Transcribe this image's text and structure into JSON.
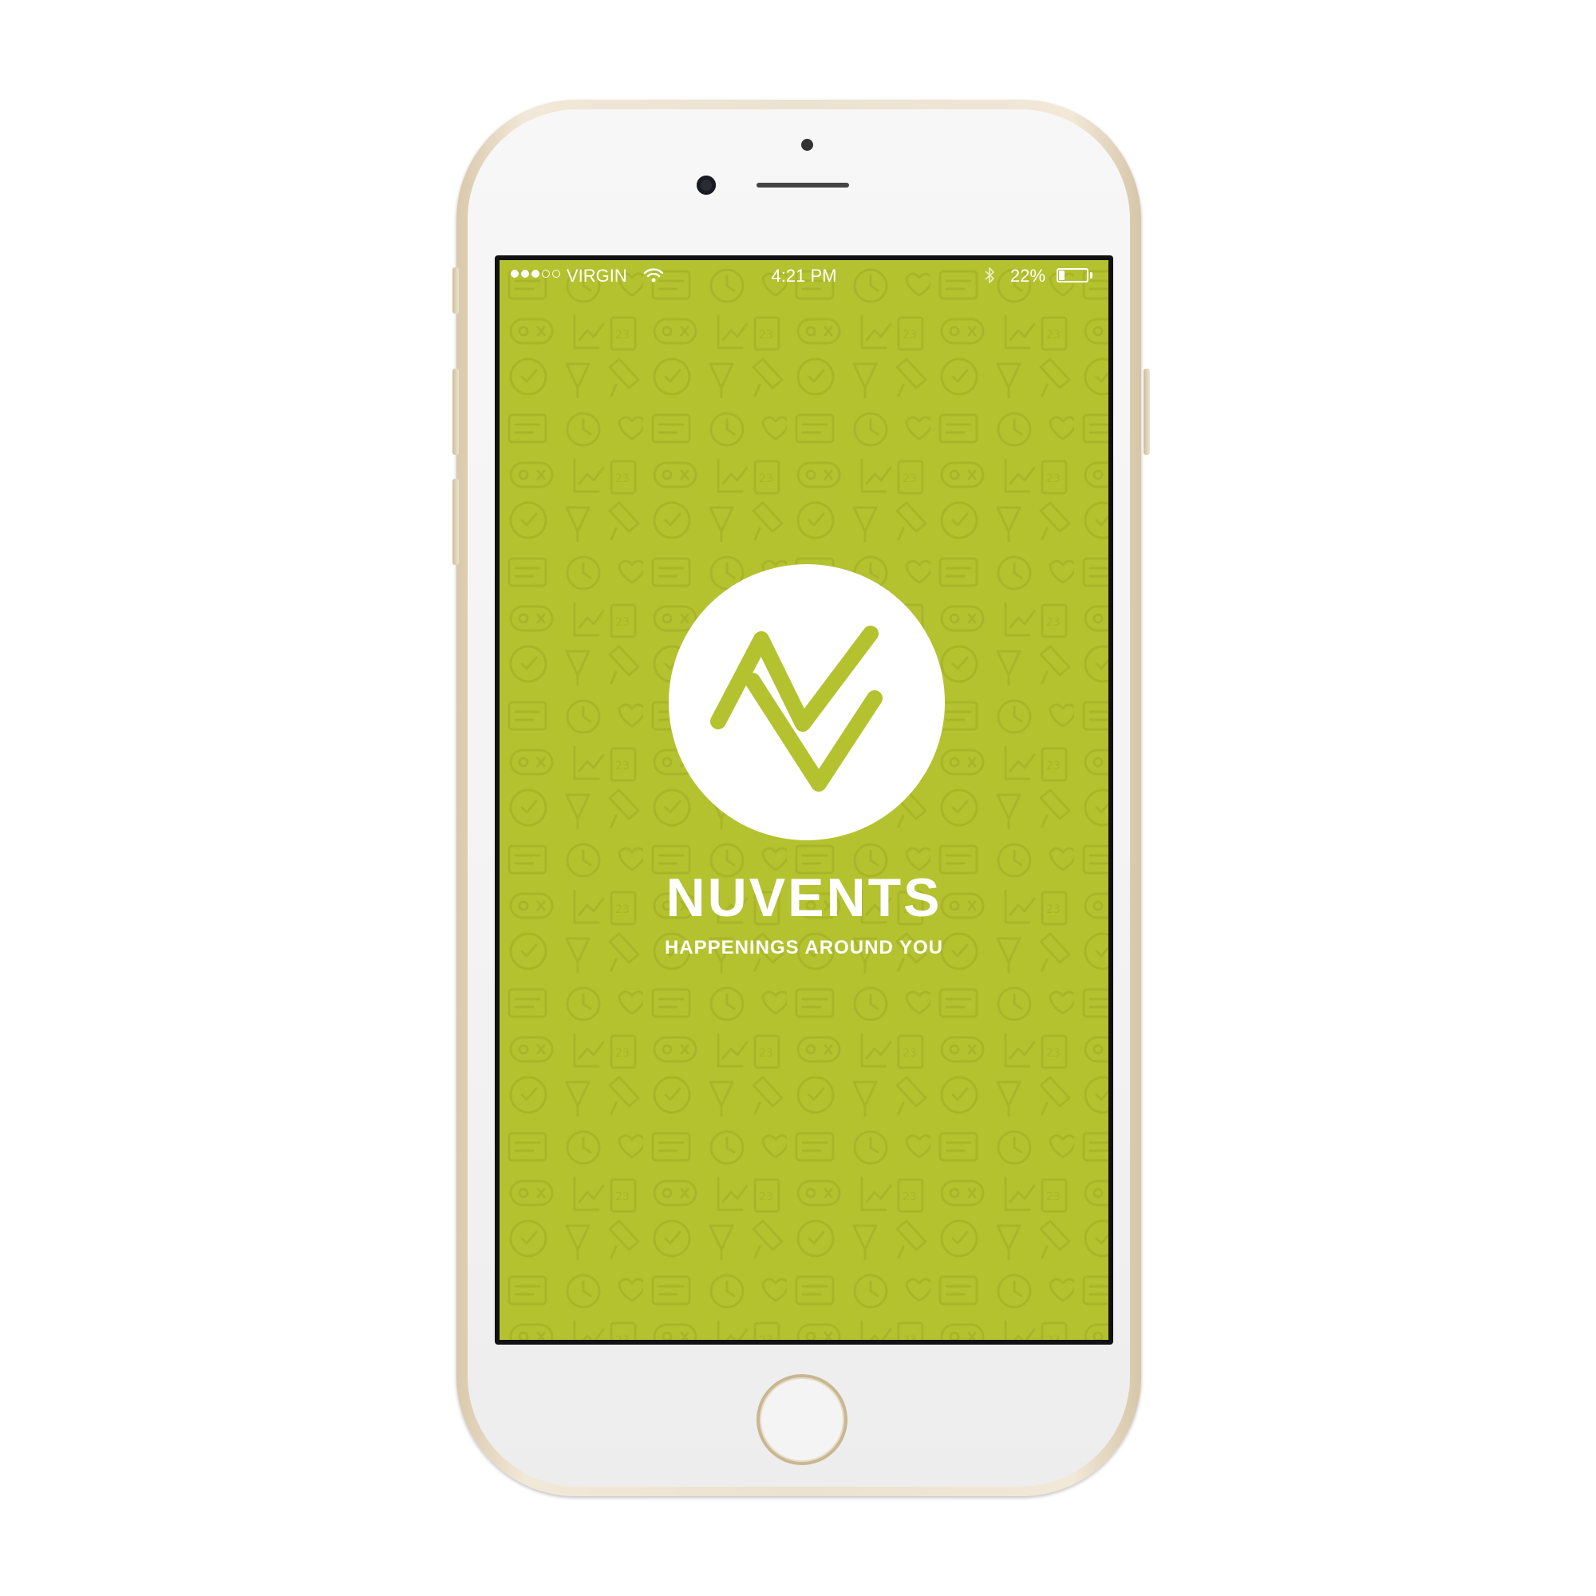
{
  "statusbar": {
    "carrier": "VIRGIN",
    "time": "4:21 PM",
    "battery_percent_label": "22%",
    "battery_level": 0.22,
    "signal_bars_filled": 3,
    "signal_bars_total": 5
  },
  "splash": {
    "brand_name": "NUVENTS",
    "tagline": "HAPPENINGS AROUND YOU"
  },
  "colors": {
    "brand_green": "#b4c22f",
    "pattern_stroke": "#a9b528",
    "phone_gold": "#ece2d0",
    "logo_white": "#ffffff"
  },
  "icons": [
    "signal-dots-icon",
    "wifi-icon",
    "bluetooth-icon",
    "battery-icon",
    "nuvents-logo-icon"
  ]
}
